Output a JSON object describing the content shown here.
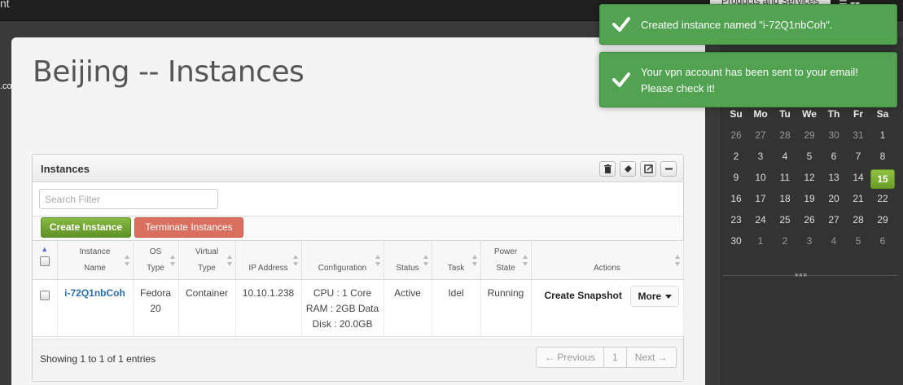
{
  "topbar": {
    "brand_fragment": "nt",
    "products_fragment": "Products and Services",
    "menu_fragment": "☰ ▾▾"
  },
  "com_fragment": ".com",
  "page": {
    "title": "Beijing -- Instances"
  },
  "widget": {
    "title": "Instances",
    "header_icons": [
      "trash-icon",
      "eraser-icon",
      "external-link-icon",
      "minus-icon"
    ],
    "search_placeholder": "Search Filter",
    "create_button": "Create Instance",
    "terminate_button": "Terminate Instances",
    "columns": [
      {
        "line1": "",
        "line2": ""
      },
      {
        "line1": "Instance",
        "line2": "Name"
      },
      {
        "line1": "OS",
        "line2": "Type"
      },
      {
        "line1": "Virtual",
        "line2": "Type"
      },
      {
        "line1": "",
        "line2": "IP Address"
      },
      {
        "line1": "",
        "line2": "Configuration"
      },
      {
        "line1": "",
        "line2": "Status"
      },
      {
        "line1": "",
        "line2": "Task"
      },
      {
        "line1": "Power",
        "line2": "State"
      },
      {
        "line1": "",
        "line2": "Actions"
      }
    ],
    "rows": [
      {
        "name": "i-72Q1nbCoh",
        "os_line1": "Fedora",
        "os_line2": "20",
        "virtual_type": "Container",
        "ip": "10.10.1.238",
        "config_cpu": "CPU : 1 Core",
        "config_ram": "RAM : 2GB Data",
        "config_disk": "Disk : 20.0GB",
        "status": "Active",
        "task": "Idel",
        "power_state": "Running",
        "action_snapshot": "Create Snapshot",
        "action_more": "More"
      }
    ],
    "footer_info": "Showing 1 to 1 of 1 entries",
    "pager": {
      "previous": "← Previous",
      "page": "1",
      "next": "Next →"
    }
  },
  "calendar": {
    "weekdays": [
      "Su",
      "Mo",
      "Tu",
      "We",
      "Th",
      "Fr",
      "Sa"
    ],
    "weeks": [
      [
        "26",
        "27",
        "28",
        "29",
        "30",
        "31",
        "1"
      ],
      [
        "2",
        "3",
        "4",
        "5",
        "6",
        "7",
        "8"
      ],
      [
        "9",
        "10",
        "11",
        "12",
        "13",
        "14",
        "15"
      ],
      [
        "16",
        "17",
        "18",
        "19",
        "20",
        "21",
        "22"
      ],
      [
        "23",
        "24",
        "25",
        "26",
        "27",
        "28",
        "29"
      ],
      [
        "30",
        "1",
        "2",
        "3",
        "4",
        "5",
        "6"
      ]
    ],
    "today": "15"
  },
  "notifications": [
    {
      "line1": "Created instance named \"i-72Q1nbCoh\".",
      "line2": ""
    },
    {
      "line1": "Your vpn account has been sent to your email!",
      "line2": "Please check it!"
    }
  ],
  "colors": {
    "success_toast": "#51a351",
    "create_button": "#6ea32f",
    "terminate_button": "#d9705f",
    "link": "#2a6db0",
    "today_highlight": "#7fb337"
  }
}
